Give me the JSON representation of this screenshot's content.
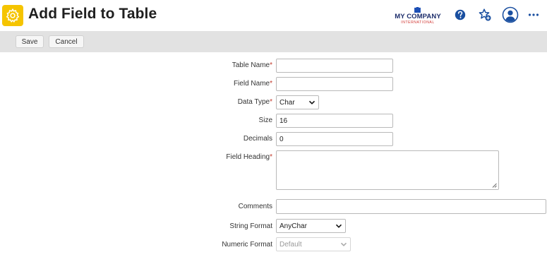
{
  "header": {
    "title": "Add Field to Table",
    "logo": {
      "main": "MY COMPANY",
      "sub": "INTERNATIONAL"
    },
    "icons": [
      "settings-gear-icon",
      "help-icon",
      "favorite-add-icon",
      "user-profile-icon",
      "more-icon"
    ],
    "accent_color": "#1a4fa0",
    "app_icon_color": "#f5c400"
  },
  "toolbar": {
    "save_label": "Save",
    "cancel_label": "Cancel"
  },
  "form": {
    "table_name": {
      "label": "Table Name",
      "required": "*",
      "value": ""
    },
    "field_name": {
      "label": "Field Name",
      "required": "*",
      "value": ""
    },
    "data_type": {
      "label": "Data Type",
      "required": "*",
      "value": "Char"
    },
    "size": {
      "label": "Size",
      "value": "16"
    },
    "decimals": {
      "label": "Decimals",
      "value": "0"
    },
    "field_heading": {
      "label": "Field Heading",
      "required": "*",
      "value": ""
    },
    "comments": {
      "label": "Comments",
      "value": ""
    },
    "string_format": {
      "label": "String Format",
      "value": "AnyChar"
    },
    "numeric_format": {
      "label": "Numeric Format",
      "value": "Default"
    }
  }
}
